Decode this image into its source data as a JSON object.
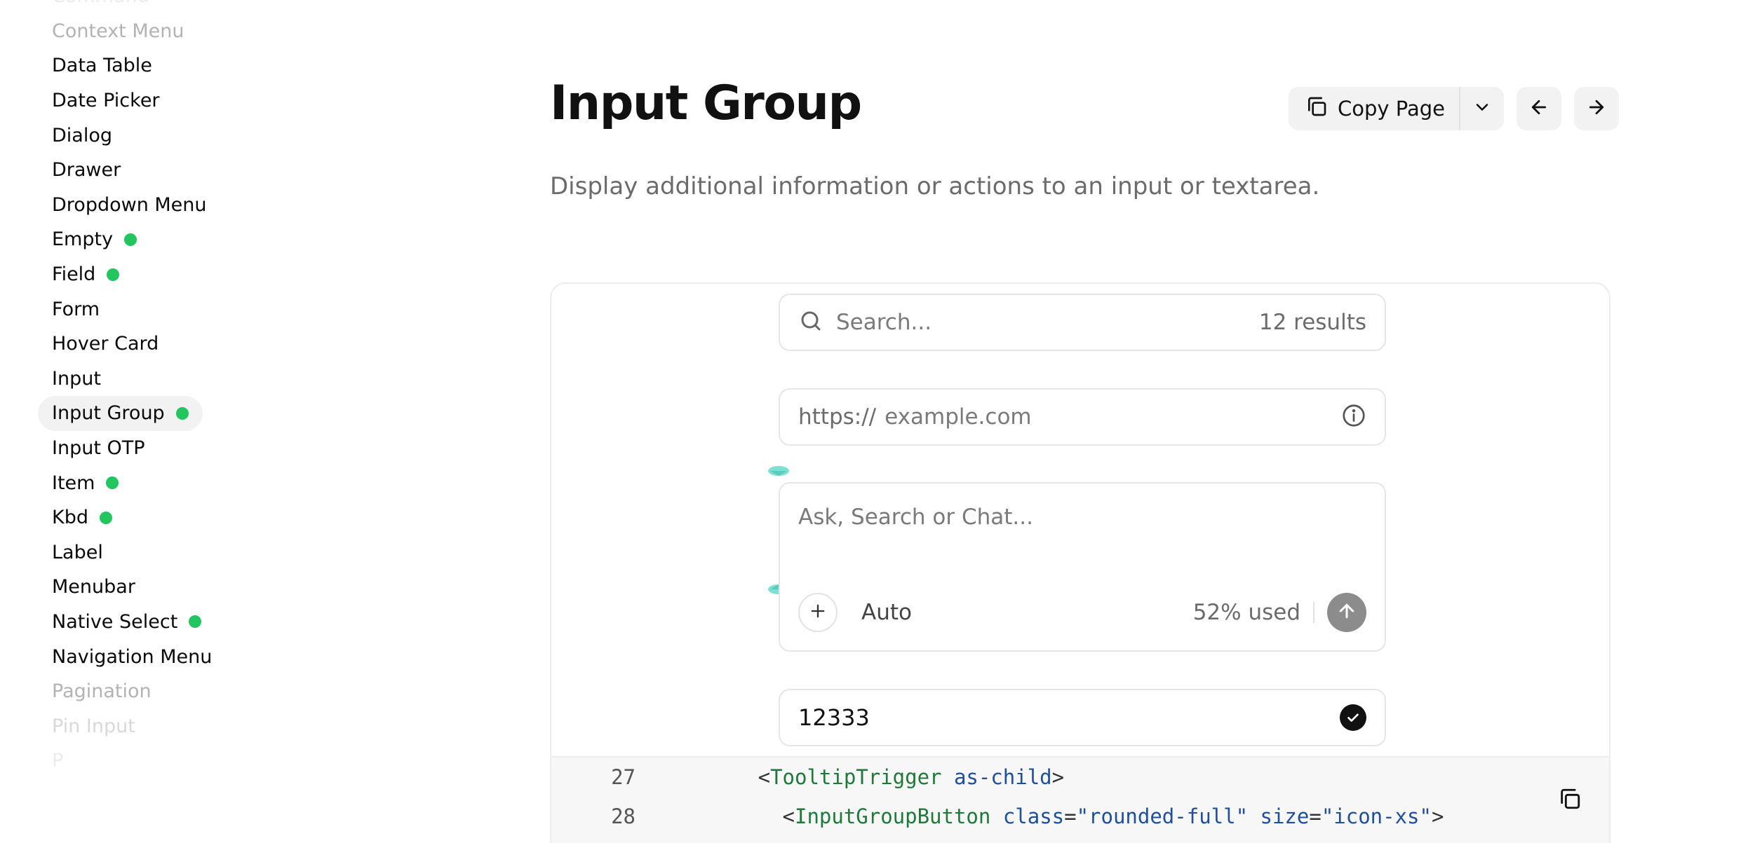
{
  "sidebar": {
    "items": [
      {
        "label": "Command",
        "new": false,
        "active": false,
        "fade": "fade3"
      },
      {
        "label": "Context Menu",
        "new": false,
        "active": false,
        "fade": "fade1"
      },
      {
        "label": "Data Table",
        "new": false,
        "active": false,
        "fade": ""
      },
      {
        "label": "Date Picker",
        "new": false,
        "active": false,
        "fade": ""
      },
      {
        "label": "Dialog",
        "new": false,
        "active": false,
        "fade": ""
      },
      {
        "label": "Drawer",
        "new": false,
        "active": false,
        "fade": ""
      },
      {
        "label": "Dropdown Menu",
        "new": false,
        "active": false,
        "fade": ""
      },
      {
        "label": "Empty",
        "new": true,
        "active": false,
        "fade": ""
      },
      {
        "label": "Field",
        "new": true,
        "active": false,
        "fade": ""
      },
      {
        "label": "Form",
        "new": false,
        "active": false,
        "fade": ""
      },
      {
        "label": "Hover Card",
        "new": false,
        "active": false,
        "fade": ""
      },
      {
        "label": "Input",
        "new": false,
        "active": false,
        "fade": ""
      },
      {
        "label": "Input Group",
        "new": true,
        "active": true,
        "fade": ""
      },
      {
        "label": "Input OTP",
        "new": false,
        "active": false,
        "fade": ""
      },
      {
        "label": "Item",
        "new": true,
        "active": false,
        "fade": ""
      },
      {
        "label": "Kbd",
        "new": true,
        "active": false,
        "fade": ""
      },
      {
        "label": "Label",
        "new": false,
        "active": false,
        "fade": ""
      },
      {
        "label": "Menubar",
        "new": false,
        "active": false,
        "fade": ""
      },
      {
        "label": "Native Select",
        "new": true,
        "active": false,
        "fade": ""
      },
      {
        "label": "Navigation Menu",
        "new": false,
        "active": false,
        "fade": ""
      },
      {
        "label": "Pagination",
        "new": false,
        "active": false,
        "fade": "fade1"
      },
      {
        "label": "Pin Input",
        "new": false,
        "active": false,
        "fade": "fade2"
      },
      {
        "label": "P",
        "new": false,
        "active": false,
        "fade": "fade3"
      }
    ]
  },
  "header": {
    "title": "Input Group",
    "description": "Display additional information or actions to an input or textarea.",
    "copy_page_label": "Copy Page"
  },
  "preview": {
    "search": {
      "placeholder": "Search...",
      "results": "12 results"
    },
    "url": {
      "prefix": "https://",
      "placeholder": "example.com"
    },
    "chat": {
      "placeholder": "Ask, Search or Chat...",
      "mode": "Auto",
      "usage": "52% used"
    },
    "value_field": {
      "value": "12333"
    }
  },
  "code": {
    "lines": [
      {
        "number": "27",
        "indent": "          ",
        "tag": "TooltipTrigger",
        "attrs": [
          {
            "name": "as-child"
          }
        ]
      },
      {
        "number": "28",
        "indent": "            ",
        "tag": "InputGroupButton",
        "attrs": [
          {
            "name": "class",
            "value": "rounded-full"
          },
          {
            "name": "size",
            "value": "icon-xs"
          }
        ]
      }
    ]
  },
  "colors": {
    "new_dot": "#22c55e",
    "tag": "#1f7a3a",
    "attr": "#1f4f9c"
  },
  "icons": [
    "copy-icon",
    "chevron-down-icon",
    "arrow-left-icon",
    "arrow-right-icon",
    "search-icon",
    "info-icon",
    "plus-icon",
    "arrow-up-icon",
    "check-circle-icon"
  ]
}
